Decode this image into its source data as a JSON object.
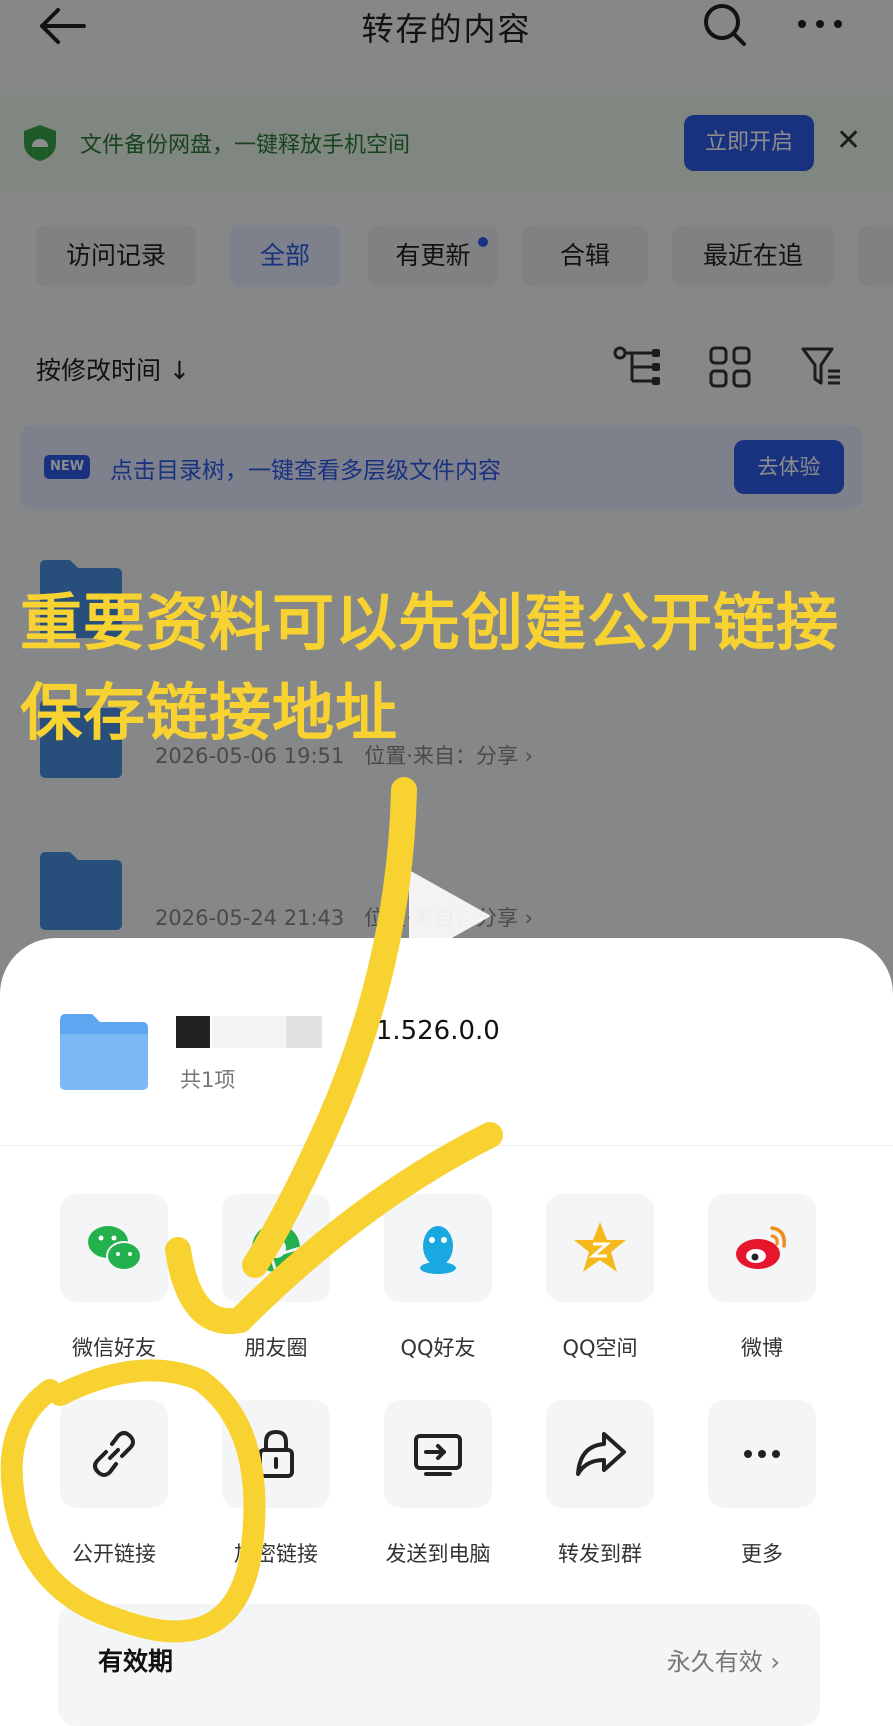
{
  "header": {
    "title": "转存的内容"
  },
  "banner": {
    "text": "文件备份网盘，一键释放手机空间",
    "button": "立即开启"
  },
  "tabs": [
    {
      "label": "访问记录"
    },
    {
      "label": "全部"
    },
    {
      "label": "有更新"
    },
    {
      "label": "合辑"
    },
    {
      "label": "最近在追"
    }
  ],
  "sort": {
    "label": "按修改时间 ↓"
  },
  "tip": {
    "badge": "NEW",
    "text": "点击目录树，一键查看多层级文件内容",
    "button": "去体验"
  },
  "files": [
    {
      "time": "2026-05-06 19:51",
      "source": "位置·来自：分享 ›"
    },
    {
      "time": "2026-05-24 21:43",
      "source": "位置·来自：分享 ›"
    }
  ],
  "caption": {
    "line1": "重要资料可以先创建公开链接",
    "line2": "保存链接地址"
  },
  "sheet": {
    "name": "V1.526.0.0",
    "count": "共1项",
    "row1": [
      {
        "label": "微信好友",
        "icon": "wechat-icon"
      },
      {
        "label": "朋友圈",
        "icon": "moments-icon"
      },
      {
        "label": "QQ好友",
        "icon": "qq-icon"
      },
      {
        "label": "QQ空间",
        "icon": "qzone-icon"
      },
      {
        "label": "微博",
        "icon": "weibo-icon"
      }
    ],
    "row2": [
      {
        "label": "公开链接",
        "icon": "link-icon"
      },
      {
        "label": "加密链接",
        "icon": "lock-icon"
      },
      {
        "label": "发送到电脑",
        "icon": "send-to-pc-icon"
      },
      {
        "label": "转发到群",
        "icon": "forward-icon"
      },
      {
        "label": "更多",
        "icon": "more-icon"
      }
    ],
    "validity_label": "有效期",
    "validity_value": "永久有效 ›"
  },
  "colors": {
    "accent": "#2f5bea",
    "highlight": "#f7d231"
  }
}
